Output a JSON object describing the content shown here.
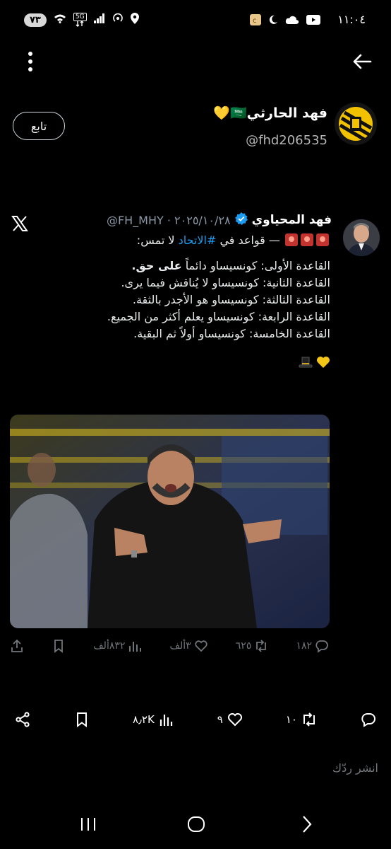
{
  "status_bar": {
    "time": "١١:٠٤",
    "battery": "٧٣",
    "network": "5G"
  },
  "author": {
    "name": "فهد الحارثي🇸🇦💛",
    "handle": "@fhd206535",
    "follow_label": "تابع"
  },
  "quoted_tweet": {
    "name": "فهد المحياوي",
    "handle_date": "@FH_MHY · ٢٠٢٥/١٠/٢٨",
    "line1_suffix": " — قواعد في ",
    "hashtag": "#الاتحاد",
    "line1_end": " لا تمس:",
    "rule1_prefix": "القاعدة الأولى: كونسيساو دائماً ",
    "rule1_bold": "على حق.",
    "rule2": "القاعدة الثانية: كونسيساو لا يُناقش فيما يرى.",
    "rule3": "القاعدة الثالثة: كونسيساو هو الأجدر بالثقة.",
    "rule4": "القاعدة الرابعة: كونسيساو يعلم أكثر من الجميع.",
    "rule5": "القاعدة الخامسة: كونسيساو أولاً ثم البقية.",
    "actions": {
      "replies": "١٨٢",
      "retweets": "٦٢٥",
      "likes": "٣ألف",
      "views": "٨٣٢ألف"
    }
  },
  "main_actions": {
    "replies": "",
    "retweets": "١٠",
    "likes": "٩",
    "views": "٨٫٢K"
  },
  "reply_placeholder": "انشر ردّك",
  "icons": [
    "back-arrow-icon",
    "more-icon",
    "verified-icon",
    "x-logo-icon",
    "reply-icon",
    "retweet-icon",
    "like-icon",
    "views-icon",
    "bookmark-icon",
    "share-icon",
    "recents-icon",
    "home-icon",
    "nav-back-icon"
  ]
}
